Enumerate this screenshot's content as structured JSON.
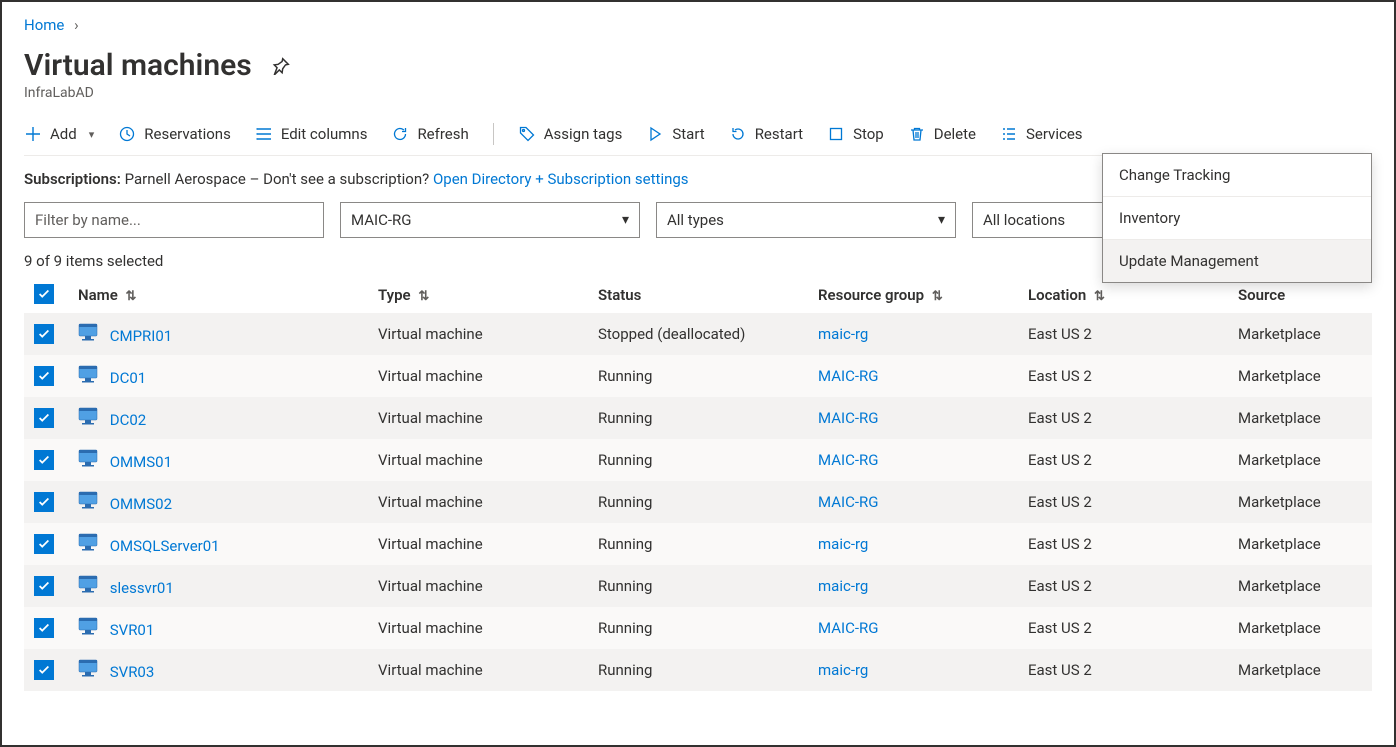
{
  "breadcrumb": {
    "home": "Home"
  },
  "page": {
    "title": "Virtual machines",
    "directory": "InfraLabAD"
  },
  "toolbar": {
    "add": "Add",
    "reservations": "Reservations",
    "edit_columns": "Edit columns",
    "refresh": "Refresh",
    "assign_tags": "Assign tags",
    "start": "Start",
    "restart": "Restart",
    "stop": "Stop",
    "delete": "Delete",
    "services": "Services"
  },
  "services_menu": {
    "change_tracking": "Change Tracking",
    "inventory": "Inventory",
    "update_management": "Update Management"
  },
  "subscriptions": {
    "label": "Subscriptions:",
    "value": "Parnell Aerospace",
    "prompt": "– Don't see a subscription?",
    "link": "Open Directory + Subscription settings"
  },
  "filters": {
    "name_placeholder": "Filter by name...",
    "resource_group": "MAIC-RG",
    "types": "All types",
    "locations": "All locations"
  },
  "selection": {
    "text": "9 of 9 items selected"
  },
  "columns": {
    "name": "Name",
    "type": "Type",
    "status": "Status",
    "resource_group": "Resource group",
    "location": "Location",
    "source": "Source"
  },
  "rows": [
    {
      "name": "CMPRI01",
      "type": "Virtual machine",
      "status": "Stopped (deallocated)",
      "rg": "maic-rg",
      "location": "East US 2",
      "source": "Marketplace"
    },
    {
      "name": "DC01",
      "type": "Virtual machine",
      "status": "Running",
      "rg": "MAIC-RG",
      "location": "East US 2",
      "source": "Marketplace"
    },
    {
      "name": "DC02",
      "type": "Virtual machine",
      "status": "Running",
      "rg": "MAIC-RG",
      "location": "East US 2",
      "source": "Marketplace"
    },
    {
      "name": "OMMS01",
      "type": "Virtual machine",
      "status": "Running",
      "rg": "MAIC-RG",
      "location": "East US 2",
      "source": "Marketplace"
    },
    {
      "name": "OMMS02",
      "type": "Virtual machine",
      "status": "Running",
      "rg": "MAIC-RG",
      "location": "East US 2",
      "source": "Marketplace"
    },
    {
      "name": "OMSQLServer01",
      "type": "Virtual machine",
      "status": "Running",
      "rg": "maic-rg",
      "location": "East US 2",
      "source": "Marketplace"
    },
    {
      "name": "slessvr01",
      "type": "Virtual machine",
      "status": "Running",
      "rg": "maic-rg",
      "location": "East US 2",
      "source": "Marketplace"
    },
    {
      "name": "SVR01",
      "type": "Virtual machine",
      "status": "Running",
      "rg": "MAIC-RG",
      "location": "East US 2",
      "source": "Marketplace"
    },
    {
      "name": "SVR03",
      "type": "Virtual machine",
      "status": "Running",
      "rg": "maic-rg",
      "location": "East US 2",
      "source": "Marketplace"
    }
  ]
}
